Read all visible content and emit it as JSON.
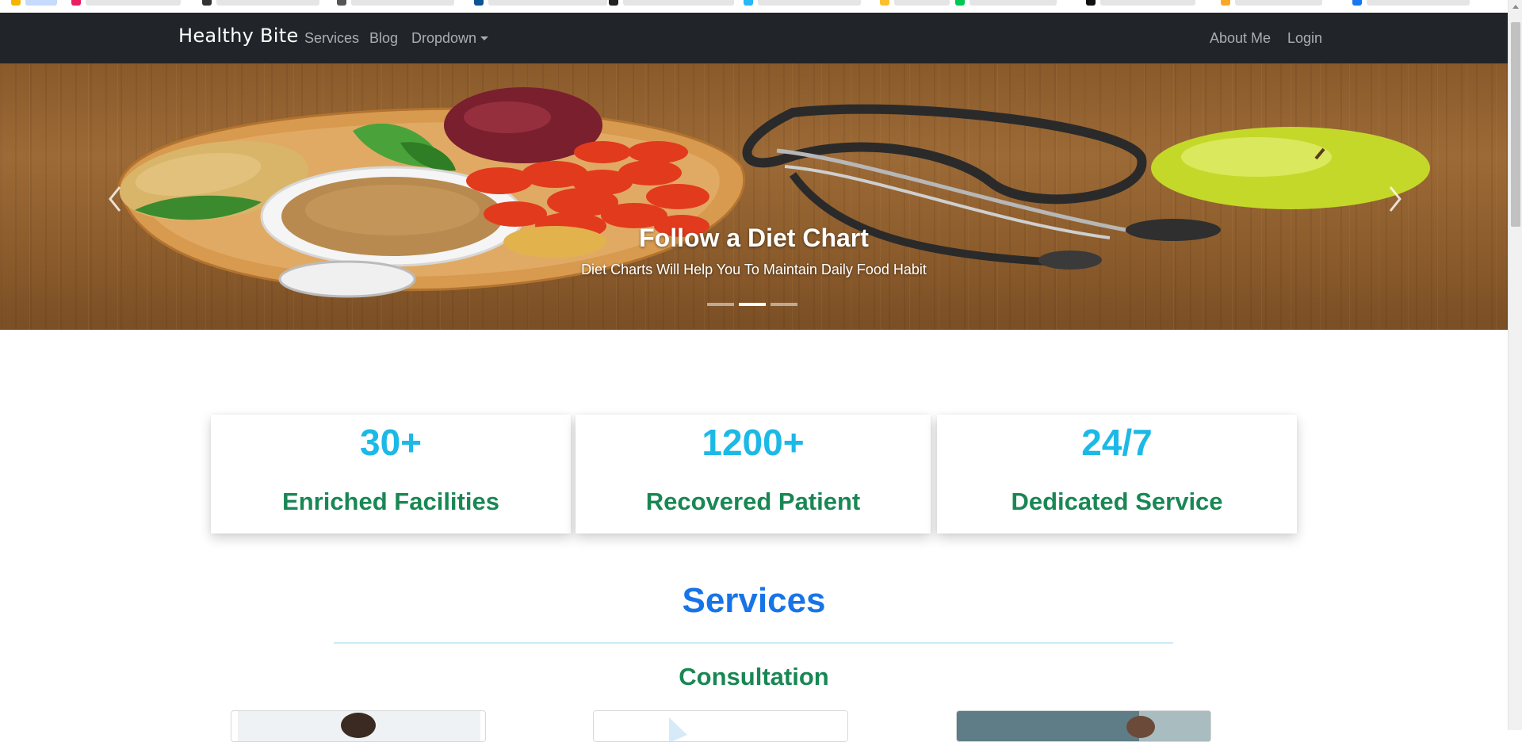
{
  "navbar": {
    "brand": "Healthy Bite",
    "links": [
      "Services",
      "Blog",
      "Dropdown"
    ],
    "right_links": [
      "About Me",
      "Login"
    ]
  },
  "hero": {
    "title": "Follow a Diet Chart",
    "subtitle": "Diet Charts Will Help You To Maintain Daily Food Habit",
    "slide_count": 3,
    "active_slide": 2
  },
  "stats": [
    {
      "number": "30+",
      "label": "Enriched Facilities"
    },
    {
      "number": "1200+",
      "label": "Recovered Patient"
    },
    {
      "number": "24/7",
      "label": "Dedicated Service"
    }
  ],
  "services": {
    "title": "Services",
    "subtitle": "Consultation"
  },
  "colors": {
    "navbar_bg": "#212529",
    "stat_number": "#1cb9e6",
    "stat_label": "#198754",
    "services_title": "#1774e8"
  }
}
